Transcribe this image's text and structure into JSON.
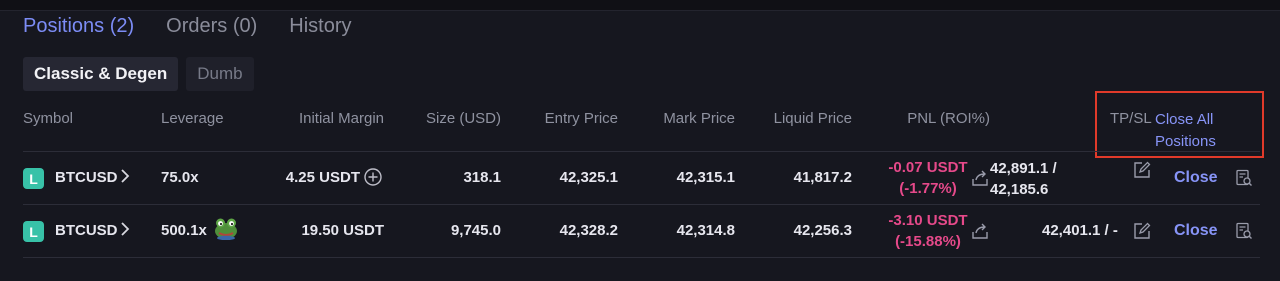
{
  "tabs": [
    {
      "label": "Positions (2)"
    },
    {
      "label": "Orders (0)"
    },
    {
      "label": "History"
    }
  ],
  "subtabs": [
    {
      "label": "Classic & Degen"
    },
    {
      "label": "Dumb"
    }
  ],
  "columns": {
    "symbol": "Symbol",
    "leverage": "Leverage",
    "initial_margin": "Initial Margin",
    "size": "Size (USD)",
    "entry_price": "Entry Price",
    "mark_price": "Mark Price",
    "liquid_price": "Liquid Price",
    "pnl": "PNL (ROI%)",
    "tpsl": "TP/SL"
  },
  "close_all": {
    "line1": "Close All",
    "line2": "Positions"
  },
  "rows": [
    {
      "symbol_badge": "L",
      "symbol": "BTCUSD",
      "leverage": "75.0x",
      "initial_margin": "4.25 USDT",
      "size": "318.1",
      "entry_price": "42,325.1",
      "mark_price": "42,315.1",
      "liquid_price": "41,817.2",
      "pnl": "-0.07 USDT",
      "roi": "(-1.77%)",
      "tpsl_line1": "42,891.1 /",
      "tpsl_line2": "42,185.6",
      "close_label": "Close"
    },
    {
      "symbol_badge": "L",
      "symbol": "BTCUSD",
      "leverage": "500.1x",
      "initial_margin": "19.50 USDT",
      "size": "9,745.0",
      "entry_price": "42,328.2",
      "mark_price": "42,314.8",
      "liquid_price": "42,256.3",
      "pnl": "-3.10 USDT",
      "roi": "(-15.88%)",
      "tpsl": "42,401.1 / -",
      "close_label": "Close"
    }
  ],
  "colors": {
    "accent": "#7c8cf5",
    "pnl_negative": "#e6498a",
    "long_badge": "#38c2a8",
    "highlight_box": "#e03a2a"
  },
  "icons": [
    "chevron-right-icon",
    "add-margin-icon",
    "frog-emoji-icon",
    "share-icon",
    "edit-icon",
    "order-search-icon"
  ]
}
